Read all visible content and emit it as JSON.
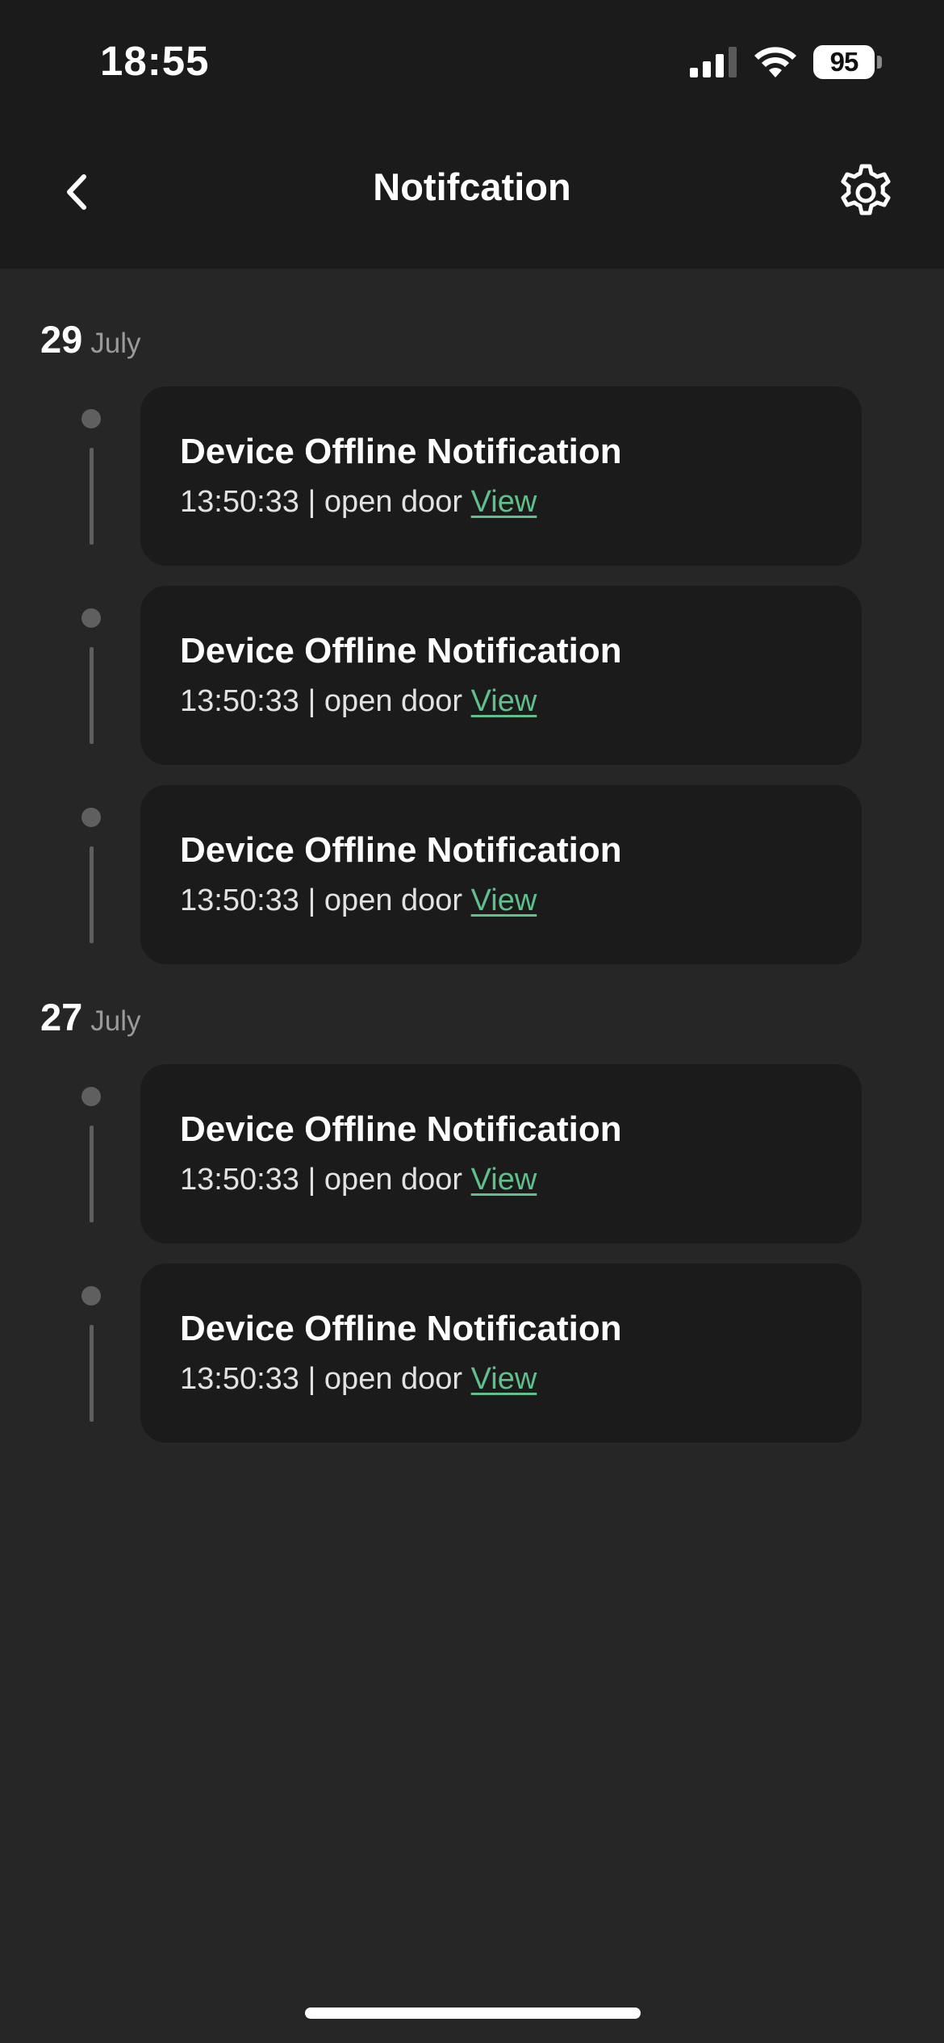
{
  "status_bar": {
    "time": "18:55",
    "battery": "95"
  },
  "header": {
    "title": "Notifcation",
    "back_icon": "chevron-left-icon",
    "settings_icon": "gear-icon"
  },
  "groups": [
    {
      "day": "29",
      "month": "July",
      "items": [
        {
          "title": "Device Offline Notification",
          "time": "13:50:33",
          "separator": "|",
          "event": "open door",
          "link": "View"
        },
        {
          "title": "Device Offline Notification",
          "time": "13:50:33",
          "separator": "|",
          "event": "open door",
          "link": "View"
        },
        {
          "title": "Device Offline Notification",
          "time": "13:50:33",
          "separator": "|",
          "event": "open door",
          "link": "View"
        }
      ]
    },
    {
      "day": "27",
      "month": "July",
      "items": [
        {
          "title": "Device Offline Notification",
          "time": "13:50:33",
          "separator": "|",
          "event": "open door",
          "link": "View"
        },
        {
          "title": "Device Offline Notification",
          "time": "13:50:33",
          "separator": "|",
          "event": "open door",
          "link": "View"
        }
      ]
    }
  ],
  "colors": {
    "background": "#262626",
    "header": "#1b1b1b",
    "card": "#1b1b1b",
    "link": "#5fc08b",
    "timeline": "#5f5f5f"
  }
}
